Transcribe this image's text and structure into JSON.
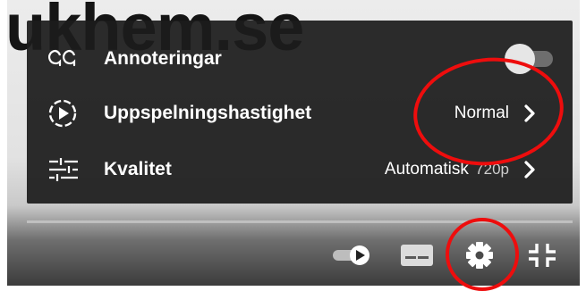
{
  "background_text": "ukhem.se",
  "settings_menu": {
    "annotations": {
      "label": "Annoteringar",
      "icon": "annotations-icon",
      "enabled": false
    },
    "speed": {
      "label": "Uppspelningshastighet",
      "value": "Normal",
      "icon": "playback-speed-icon"
    },
    "quality": {
      "label": "Kvalitet",
      "value": "Automatisk",
      "value_detail": "720p",
      "icon": "quality-sliders-icon"
    }
  },
  "player_controls": {
    "autoplay": {
      "icon": "autoplay-toggle-icon"
    },
    "subtitles": {
      "icon": "subtitles-icon"
    },
    "settings": {
      "icon": "gear-icon"
    },
    "exit_fullscreen": {
      "icon": "exit-fullscreen-icon"
    }
  },
  "annotation_colors": {
    "highlight_circle": "#ee0d0d"
  }
}
